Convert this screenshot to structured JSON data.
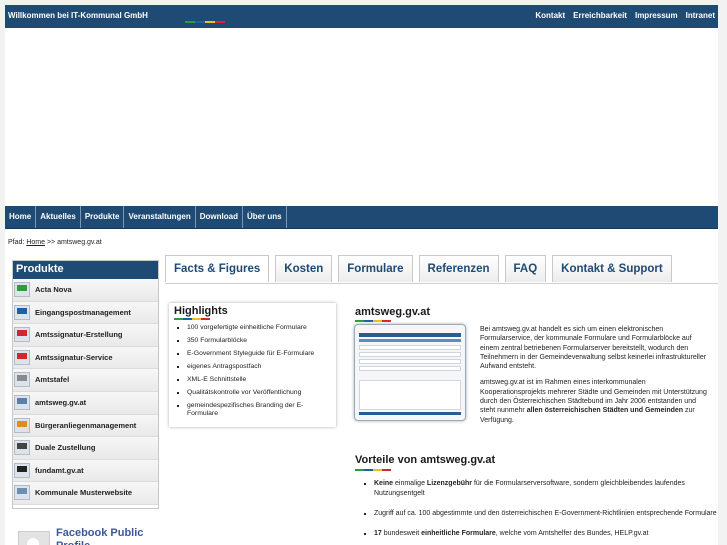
{
  "header": {
    "welcome": "Willkommen bei IT-Kommunal GmbH",
    "links": [
      "Kontakt",
      "Erreichbarkeit",
      "Impressum",
      "Intranet"
    ],
    "accent_colors": [
      "#2e9b3d",
      "#1f5fa8",
      "#e7c21f",
      "#d4262c"
    ]
  },
  "nav": {
    "items": [
      "Home",
      "Aktuelles",
      "Produkte",
      "Veranstaltungen",
      "Download",
      "Über uns"
    ]
  },
  "breadcrumb": {
    "prefix": "Pfad:",
    "home": "Home",
    "rest": ">> amtsweg.gv.at"
  },
  "sidebar": {
    "title": "Produkte",
    "items": [
      {
        "label": "Acta Nova",
        "icon": "acta-nova-icon"
      },
      {
        "label": "Eingangspostmanagement",
        "icon": "inbox-icon"
      },
      {
        "label": "Amtssignatur-Erstellung",
        "icon": "signature-icon"
      },
      {
        "label": "Amtssignatur-Service",
        "icon": "signature-service-icon"
      },
      {
        "label": "Amtstafel",
        "icon": "board-icon"
      },
      {
        "label": "amtsweg.gv.at",
        "icon": "amtsweg-icon"
      },
      {
        "label": "Bürgeranliegenmanagement",
        "icon": "citizen-icon"
      },
      {
        "label": "Duale Zustellung",
        "icon": "delivery-icon"
      },
      {
        "label": "fundamt.gv.at",
        "icon": "fundamt-icon"
      },
      {
        "label": "Kommunale Musterwebsite",
        "icon": "website-icon"
      }
    ]
  },
  "facebook": {
    "title": "Facebook Public Profile"
  },
  "tabs": [
    "Facts & Figures",
    "Kosten",
    "Formulare",
    "Referenzen",
    "FAQ",
    "Kontakt & Support"
  ],
  "highlights": {
    "title": "Highlights",
    "items": [
      "100 vorgefertigte einheitliche Formulare",
      "350 Formularblöcke",
      "E-Government Styleguide für E-Formulare",
      "eigenes Antragspostfach",
      "XML-E Schnittstelle",
      "Qualitätskontrolle vor Veröffentlichung",
      "gemeindespezifisches Branding der E-Formulare"
    ]
  },
  "amtsweg": {
    "title": "amtsweg.gv.at",
    "p1": "Bei amtsweg.gv.at handelt es sich um einen elektronischen Formularservice, der kommunale Formulare und Formularblöcke auf einem zentral betriebenen Formularserver bereitstellt, wodurch den Teilnehmern in der Gemeindeverwaltung selbst keinerlei infrastruktureller Aufwand entsteht.",
    "p2_a": "amtsweg.gv.at ist im Rahmen eines interkommunalen Kooperationsprojekts mehrerer Städte und Gemeinden mit Unterstützung durch den Österreichischen Städtebund im Jahr 2006 entstanden und steht nunmehr ",
    "p2_bold": "allen österreichischen Städten und Gemeinden",
    "p2_b": " zur Verfügung."
  },
  "vorteile": {
    "title": "Vorteile von amtsweg.gv.at",
    "items": [
      {
        "bold": "Keine",
        "pre": "",
        "mid": " einmalige ",
        "bold2": "Lizenzgebühr",
        "rest": " für die Formularserversoftware, sondern gleichbleibendes laufendes Nutzungsentgelt"
      },
      {
        "bold": "",
        "pre": "Zugriff auf ca. 100 abgestimmte und den österreichischen E-Government-Richtlinien entsprechende Formulare",
        "mid": "",
        "bold2": "",
        "rest": ""
      },
      {
        "bold": "17",
        "pre": "",
        "mid": " bundesweit ",
        "bold2": "einheitliche Formulare",
        "rest": ", welche vom Amtshelfer des Bundes, HELP.gv.at"
      }
    ]
  }
}
